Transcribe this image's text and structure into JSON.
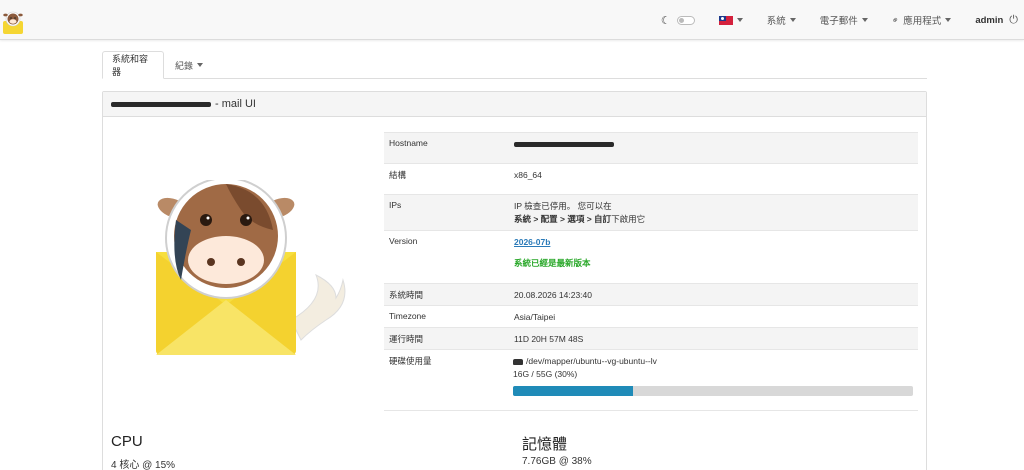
{
  "navbar": {
    "items": [
      {
        "label": "系統"
      },
      {
        "label": "電子郵件"
      },
      {
        "label": "應用程式"
      }
    ],
    "user": "admin"
  },
  "tabs": [
    {
      "label": "系統和容器"
    },
    {
      "label": "紀錄"
    }
  ],
  "panel": {
    "title_suffix": "- mail UI"
  },
  "info": {
    "hostname_label": "Hostname",
    "arch_label": "結構",
    "arch_value": "x86_64",
    "ips_label": "IPs",
    "ips_line1": "IP 檢查已停用。 您可以在",
    "ips_path": "系統 > 配置 > 選項 > 自訂",
    "ips_suffix": "下啟用它",
    "version_label": "Version",
    "version_value": "2026-07b",
    "version_status": "系統已經是最新版本",
    "time_label": "系統時間",
    "time_value": "20.08.2026 14:23:40",
    "tz_label": "Timezone",
    "tz_value": "Asia/Taipei",
    "uptime_label": "運行時間",
    "uptime_value": "11D 20H 57M 48S",
    "disk_label": "硬碟使用量",
    "disk_device": "/dev/mapper/ubuntu--vg-ubuntu--lv",
    "disk_usage": "16G / 55G (30%)",
    "disk_percent": 30
  },
  "stats": {
    "cpu_title": "CPU",
    "cpu_value": "4 核心 @ 15%",
    "mem_title": "記憶體",
    "mem_value": "7.76GB @ 38%"
  },
  "colors": {
    "accent": "#1f8bb8",
    "success": "#2aa82a",
    "link": "#2a7ab8"
  }
}
